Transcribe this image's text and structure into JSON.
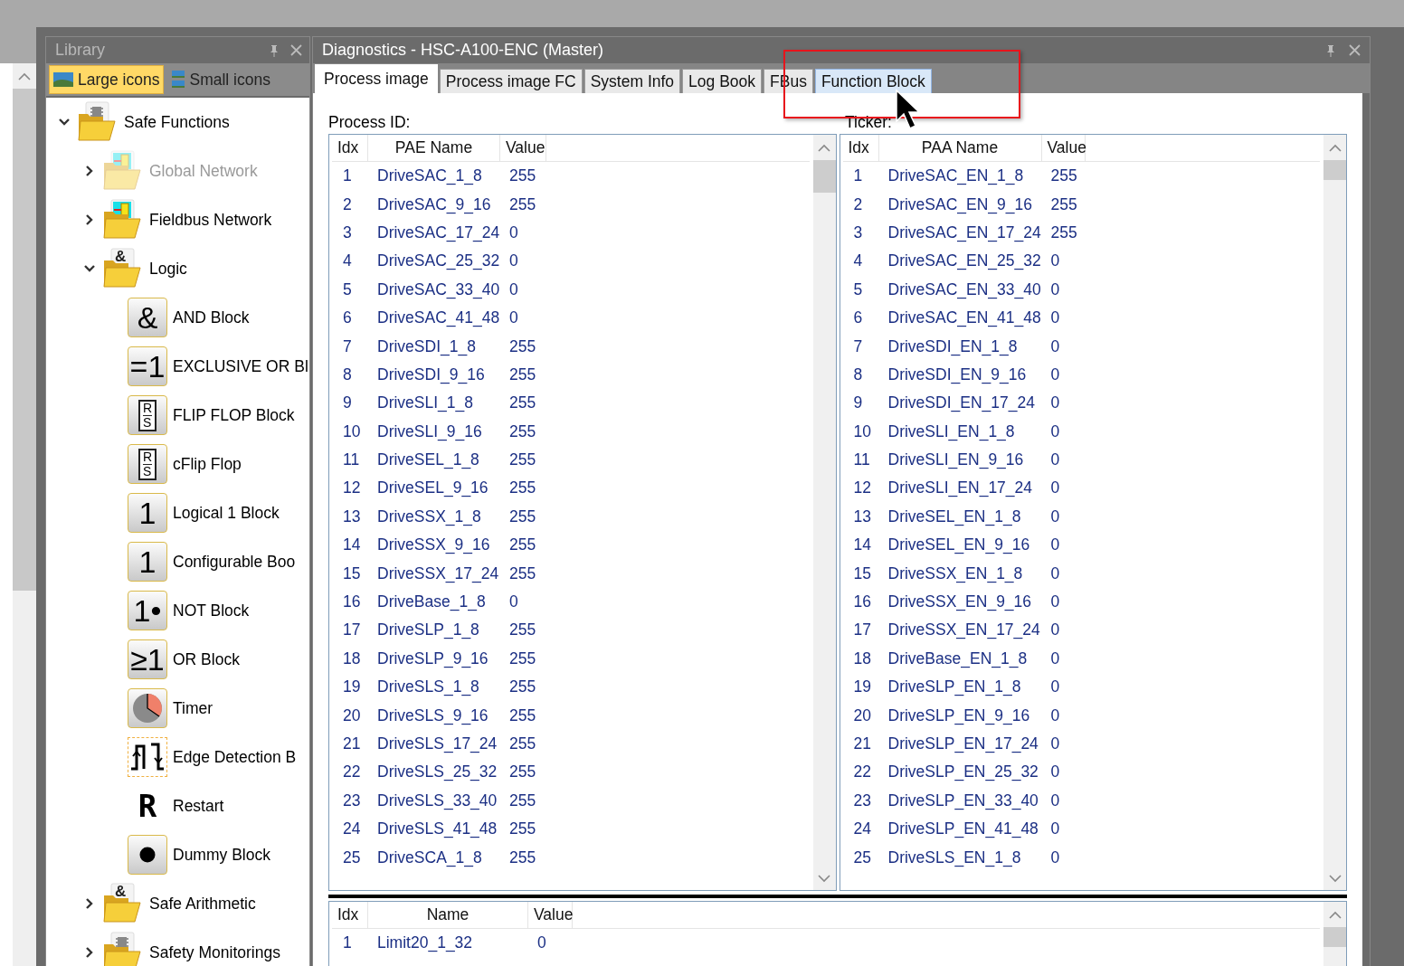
{
  "library": {
    "title": "Library",
    "view_buttons": [
      {
        "label": "Large icons",
        "selected": true,
        "kind": "large"
      },
      {
        "label": "Small icons",
        "selected": false,
        "kind": "small"
      }
    ],
    "tree": [
      {
        "label": "Safe Functions",
        "kind": "folder-chip",
        "expanded": true,
        "disabled": false,
        "children": [
          {
            "label": "Global Network",
            "kind": "folder-network",
            "expanded": false,
            "disabled": true
          },
          {
            "label": "Fieldbus Network",
            "kind": "folder-network",
            "expanded": false,
            "disabled": false
          },
          {
            "label": "Logic",
            "kind": "folder-symbol",
            "symbol": "&",
            "expanded": true,
            "disabled": false,
            "children": [
              {
                "label": "AND Block",
                "kind": "block",
                "symbol": "&",
                "disabled": false
              },
              {
                "label": "EXCLUSIVE OR Bl",
                "kind": "block",
                "symbol": "=1",
                "disabled": false
              },
              {
                "label": "FLIP FLOP Block",
                "kind": "flipflop",
                "symbols": [
                  "R",
                  "S"
                ],
                "disabled": false
              },
              {
                "label": "cFlip Flop",
                "kind": "flipflop",
                "symbols": [
                  "R",
                  "S"
                ],
                "disabled": false
              },
              {
                "label": "Logical 1 Block",
                "kind": "block",
                "symbol": "1",
                "disabled": false
              },
              {
                "label": "Configurable Boo",
                "kind": "block",
                "symbol": "1",
                "disabled": false
              },
              {
                "label": "NOT Block",
                "kind": "block",
                "symbol": "1•",
                "disabled": false
              },
              {
                "label": "OR Block",
                "kind": "block",
                "symbol": "≥1",
                "disabled": false
              },
              {
                "label": "Timer",
                "kind": "timer",
                "disabled": false
              },
              {
                "label": "Edge Detection B",
                "kind": "edge",
                "disabled": false
              },
              {
                "label": "Restart",
                "kind": "plain",
                "symbol": "R",
                "disabled": false
              },
              {
                "label": "Dummy Block",
                "kind": "dot",
                "disabled": false
              }
            ]
          },
          {
            "label": "Safe Arithmetic",
            "kind": "folder-symbol",
            "symbol": "&",
            "expanded": false,
            "disabled": false
          },
          {
            "label": "Safety Monitorings",
            "kind": "folder-chip",
            "expanded": false,
            "disabled": false
          }
        ]
      }
    ]
  },
  "diagnostics": {
    "title": "Diagnostics - HSC-A100-ENC (Master)",
    "tabs": [
      {
        "label": "Process image",
        "selected": true,
        "hovered": false
      },
      {
        "label": "Process image FC",
        "selected": false,
        "hovered": false
      },
      {
        "label": "System Info",
        "selected": false,
        "hovered": false
      },
      {
        "label": "Log Book",
        "selected": false,
        "hovered": false
      },
      {
        "label": "FBus",
        "selected": false,
        "hovered": false
      },
      {
        "label": "Function Block",
        "selected": false,
        "hovered": true
      }
    ],
    "process_id_label": "Process ID:",
    "ticker_label": "Ticker:",
    "pae_table": {
      "columns": [
        "Idx",
        "PAE Name",
        "Value"
      ],
      "rows": [
        [
          "1",
          "DriveSAC_1_8",
          "255"
        ],
        [
          "2",
          "DriveSAC_9_16",
          "255"
        ],
        [
          "3",
          "DriveSAC_17_24",
          "0"
        ],
        [
          "4",
          "DriveSAC_25_32",
          "0"
        ],
        [
          "5",
          "DriveSAC_33_40",
          "0"
        ],
        [
          "6",
          "DriveSAC_41_48",
          "0"
        ],
        [
          "7",
          "DriveSDI_1_8",
          "255"
        ],
        [
          "8",
          "DriveSDI_9_16",
          "255"
        ],
        [
          "9",
          "DriveSLI_1_8",
          "255"
        ],
        [
          "10",
          "DriveSLI_9_16",
          "255"
        ],
        [
          "11",
          "DriveSEL_1_8",
          "255"
        ],
        [
          "12",
          "DriveSEL_9_16",
          "255"
        ],
        [
          "13",
          "DriveSSX_1_8",
          "255"
        ],
        [
          "14",
          "DriveSSX_9_16",
          "255"
        ],
        [
          "15",
          "DriveSSX_17_24",
          "255"
        ],
        [
          "16",
          "DriveBase_1_8",
          "0"
        ],
        [
          "17",
          "DriveSLP_1_8",
          "255"
        ],
        [
          "18",
          "DriveSLP_9_16",
          "255"
        ],
        [
          "19",
          "DriveSLS_1_8",
          "255"
        ],
        [
          "20",
          "DriveSLS_9_16",
          "255"
        ],
        [
          "21",
          "DriveSLS_17_24",
          "255"
        ],
        [
          "22",
          "DriveSLS_25_32",
          "255"
        ],
        [
          "23",
          "DriveSLS_33_40",
          "255"
        ],
        [
          "24",
          "DriveSLS_41_48",
          "255"
        ],
        [
          "25",
          "DriveSCA_1_8",
          "255"
        ]
      ]
    },
    "paa_table": {
      "columns": [
        "Idx",
        "PAA Name",
        "Value"
      ],
      "rows": [
        [
          "1",
          "DriveSAC_EN_1_8",
          "255"
        ],
        [
          "2",
          "DriveSAC_EN_9_16",
          "255"
        ],
        [
          "3",
          "DriveSAC_EN_17_24",
          "255"
        ],
        [
          "4",
          "DriveSAC_EN_25_32",
          "0"
        ],
        [
          "5",
          "DriveSAC_EN_33_40",
          "0"
        ],
        [
          "6",
          "DriveSAC_EN_41_48",
          "0"
        ],
        [
          "7",
          "DriveSDI_EN_1_8",
          "0"
        ],
        [
          "8",
          "DriveSDI_EN_9_16",
          "0"
        ],
        [
          "9",
          "DriveSDI_EN_17_24",
          "0"
        ],
        [
          "10",
          "DriveSLI_EN_1_8",
          "0"
        ],
        [
          "11",
          "DriveSLI_EN_9_16",
          "0"
        ],
        [
          "12",
          "DriveSLI_EN_17_24",
          "0"
        ],
        [
          "13",
          "DriveSEL_EN_1_8",
          "0"
        ],
        [
          "14",
          "DriveSEL_EN_9_16",
          "0"
        ],
        [
          "15",
          "DriveSSX_EN_1_8",
          "0"
        ],
        [
          "16",
          "DriveSSX_EN_9_16",
          "0"
        ],
        [
          "17",
          "DriveSSX_EN_17_24",
          "0"
        ],
        [
          "18",
          "DriveBase_EN_1_8",
          "0"
        ],
        [
          "19",
          "DriveSLP_EN_1_8",
          "0"
        ],
        [
          "20",
          "DriveSLP_EN_9_16",
          "0"
        ],
        [
          "21",
          "DriveSLP_EN_17_24",
          "0"
        ],
        [
          "22",
          "DriveSLP_EN_25_32",
          "0"
        ],
        [
          "23",
          "DriveSLP_EN_33_40",
          "0"
        ],
        [
          "24",
          "DriveSLP_EN_41_48",
          "0"
        ],
        [
          "25",
          "DriveSLS_EN_1_8",
          "0"
        ]
      ]
    },
    "bottom_table": {
      "columns": [
        "Idx",
        "Name",
        "Value"
      ],
      "rows": [
        [
          "1",
          "Limit20_1_32",
          "0"
        ]
      ]
    }
  },
  "annotation": {
    "highlight_box": true,
    "mouse_pointer": true
  }
}
